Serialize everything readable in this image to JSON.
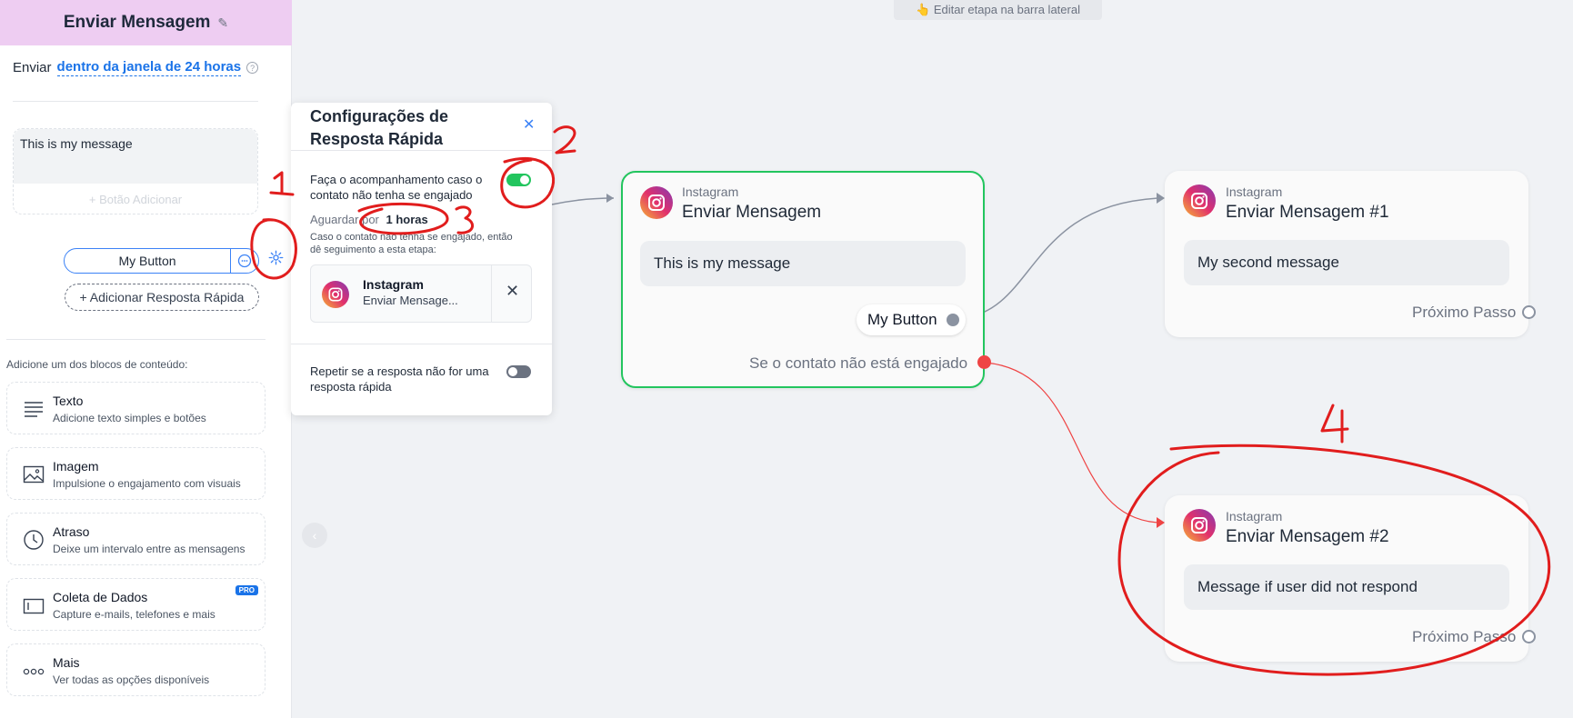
{
  "sidebar": {
    "title": "Enviar Mensagem",
    "send_label": "Enviar",
    "send_window": "dentro da janela de 24 horas",
    "message_text": "This is my message",
    "add_button_label": "+ Botão Adicionar",
    "button_label": "My Button",
    "add_quick_reply": "+ Adicionar Resposta Rápida",
    "blocks_title": "Adicione um dos blocos de conteúdo:",
    "blocks": [
      {
        "title": "Texto",
        "desc": "Adicione texto simples e botões",
        "icon": "text-lines-icon"
      },
      {
        "title": "Imagem",
        "desc": "Impulsione o engajamento com visuais",
        "icon": "image-icon"
      },
      {
        "title": "Atraso",
        "desc": "Deixe um intervalo entre as mensagens",
        "icon": "clock-icon"
      },
      {
        "title": "Coleta de Dados",
        "desc": "Capture e-mails, telefones e mais",
        "icon": "form-field-icon",
        "badge": "PRO"
      },
      {
        "title": "Mais",
        "desc": "Ver todas as opções disponíveis",
        "icon": "more-dots-icon"
      }
    ]
  },
  "top_hint": "👆 Editar etapa na barra lateral",
  "popover": {
    "title": "Configurações de Resposta Rápida",
    "follow_up_text": "Faça o acompanhamento caso o contato não tenha se engajado",
    "follow_up_enabled": true,
    "wait_label": "Aguardar por",
    "wait_value": "1 horas",
    "wait_desc": "Caso o contato não tenha se engajado, então dê seguimento a esta etapa:",
    "linked_platform": "Instagram",
    "linked_step": "Enviar Mensage...",
    "repeat_text": "Repetir se a resposta não for uma resposta rápida",
    "repeat_enabled": false
  },
  "nodes": {
    "main": {
      "platform": "Instagram",
      "title": "Enviar Mensagem",
      "message": "This is my message",
      "button": "My Button",
      "no_engage": "Se o contato não está engajado"
    },
    "second": {
      "platform": "Instagram",
      "title": "Enviar Mensagem #1",
      "message": "My second message",
      "next": "Próximo Passo"
    },
    "third": {
      "platform": "Instagram",
      "title": "Enviar Mensagem #2",
      "message": "Message if user did not respond",
      "next": "Próximo Passo"
    }
  },
  "annotations": [
    "1",
    "2",
    "3",
    "4"
  ],
  "colors": {
    "header_bg": "#eecdf2",
    "accent": "#1a73e8",
    "active_border": "#22c55e",
    "annotation_red": "#e11d1d",
    "port_red": "#ef4444"
  }
}
